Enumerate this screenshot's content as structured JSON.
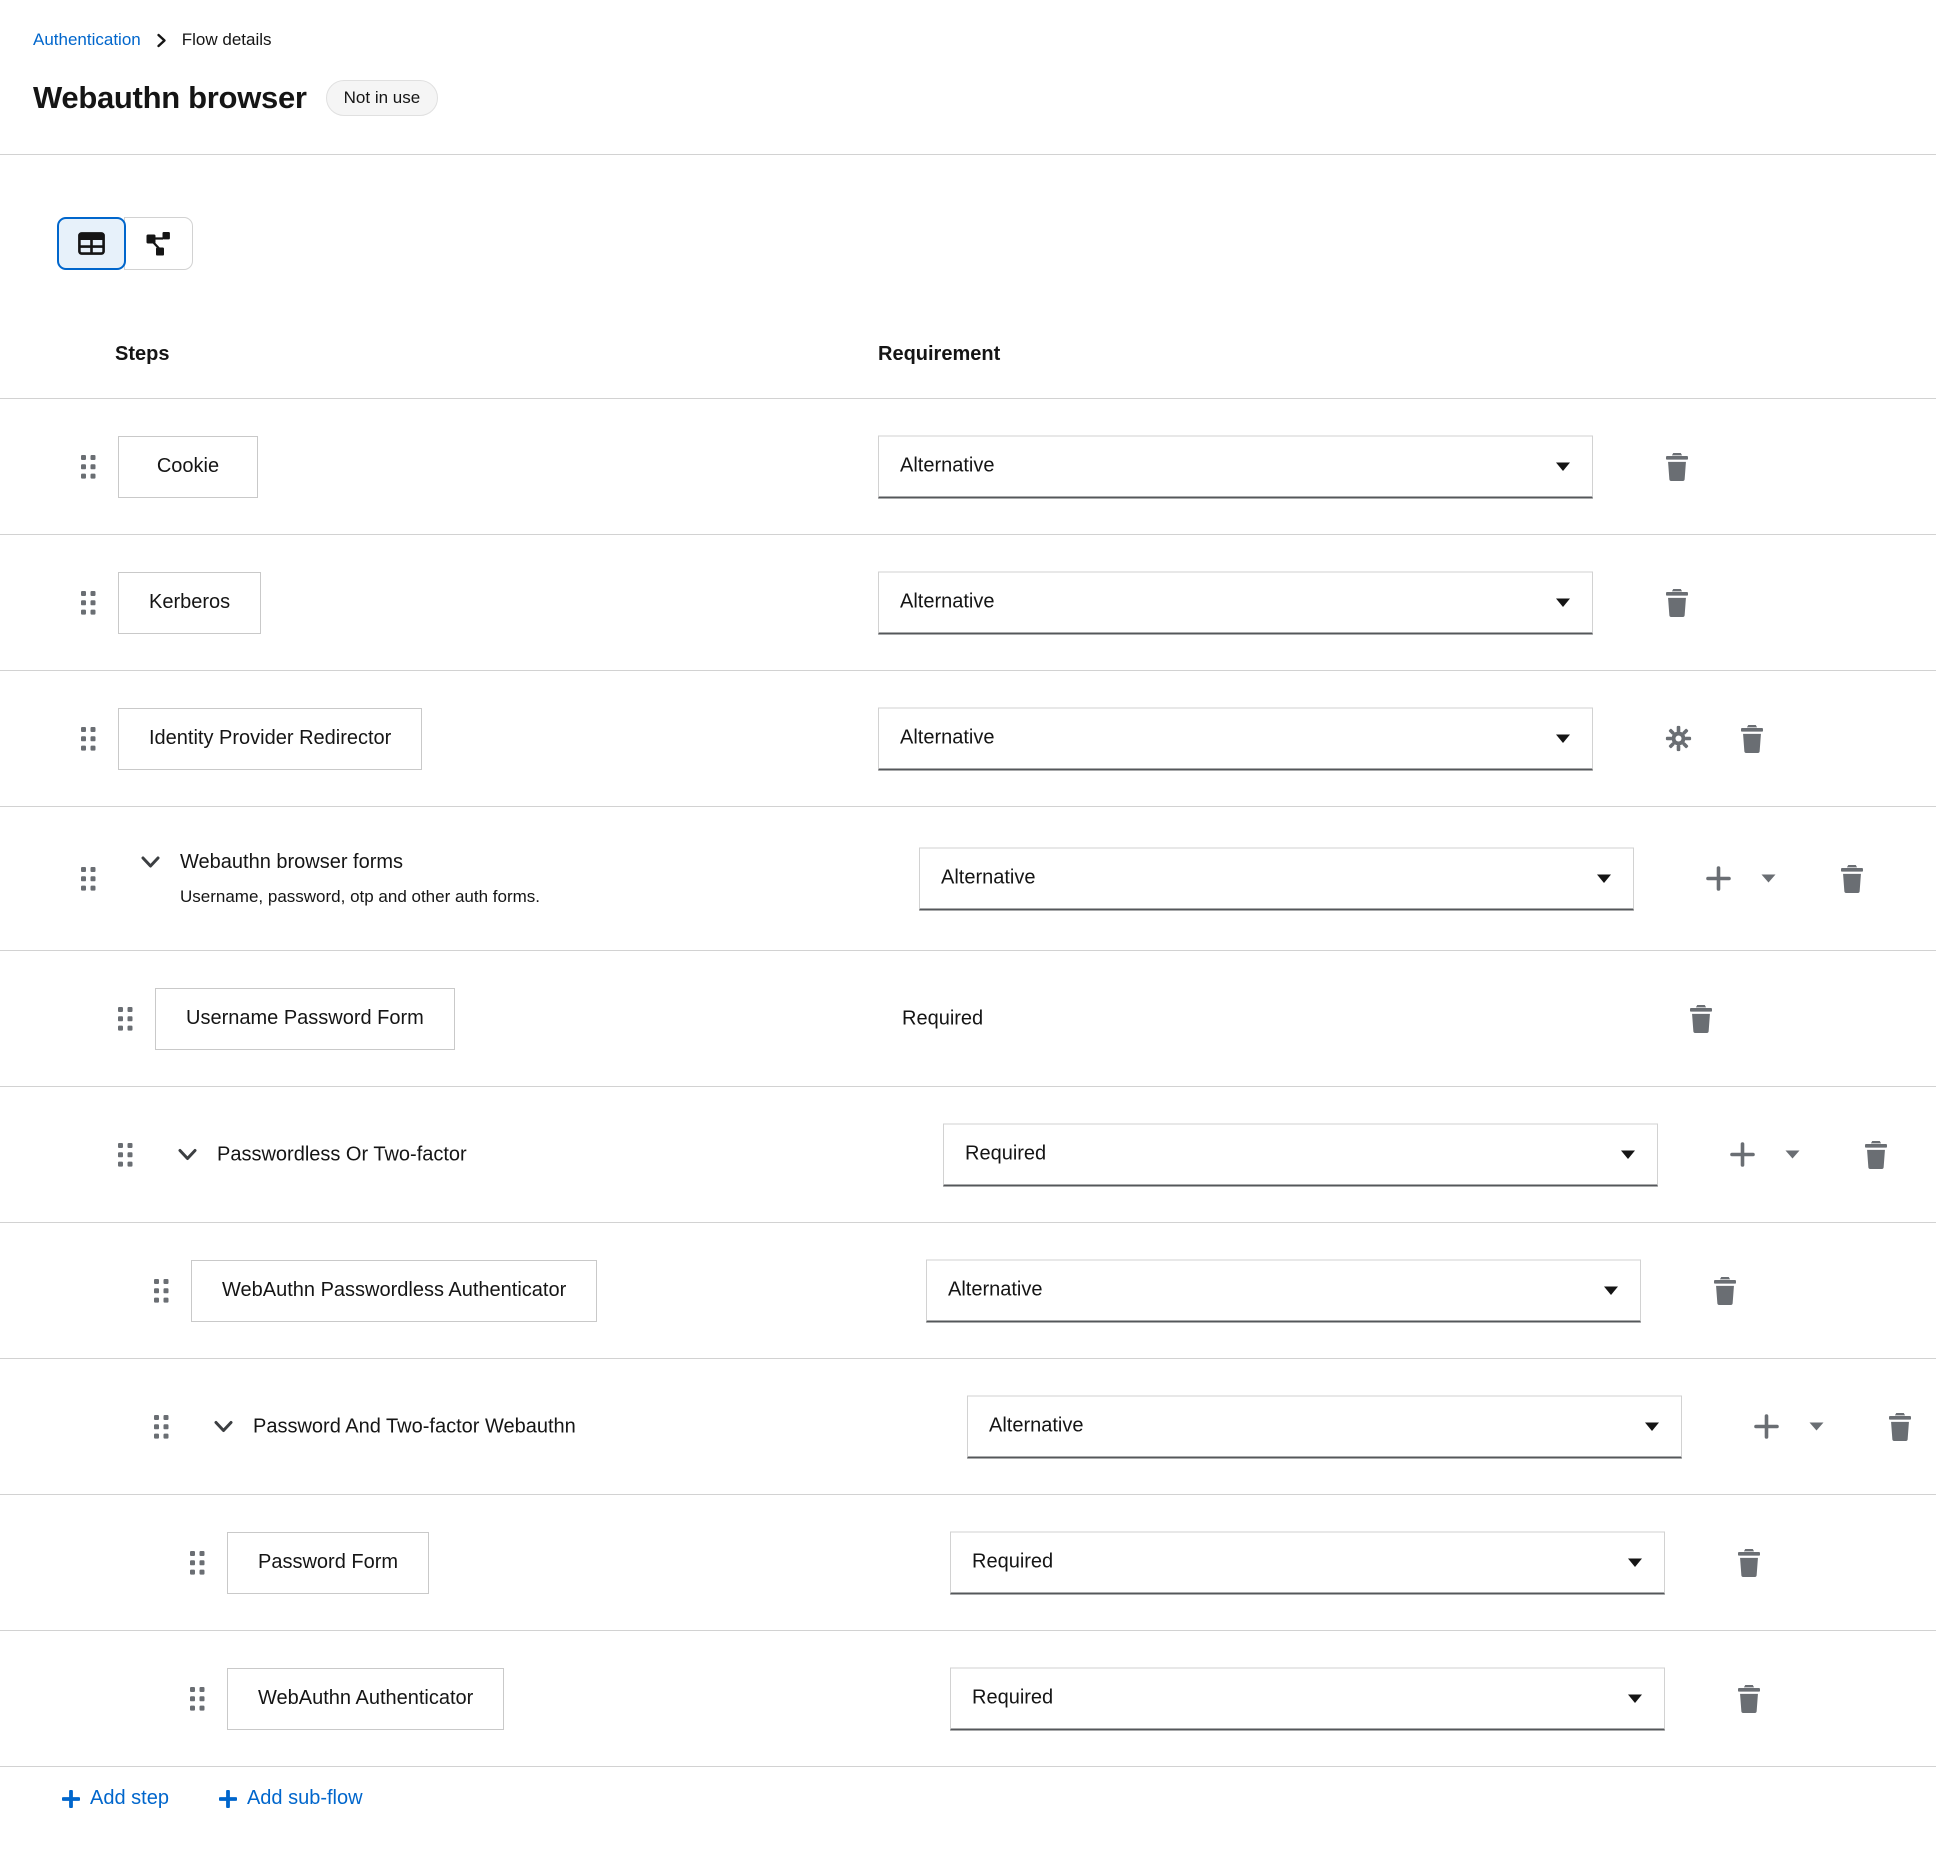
{
  "breadcrumb": {
    "items": [
      "Authentication",
      "Flow details"
    ]
  },
  "header": {
    "title": "Webauthn browser",
    "status_badge": "Not in use"
  },
  "toolbar": {
    "view_toggle": [
      {
        "id": "table-view",
        "selected": true
      },
      {
        "id": "diagram-view",
        "selected": false
      }
    ]
  },
  "table": {
    "columns": {
      "steps": "Steps",
      "requirement": "Requirement"
    },
    "rows": [
      {
        "type": "step",
        "level": 0,
        "label": "Cookie",
        "requirement": {
          "control": "select",
          "value": "Alternative"
        },
        "actions": {
          "settings": false,
          "add": false,
          "delete": true
        }
      },
      {
        "type": "step",
        "level": 0,
        "label": "Kerberos",
        "requirement": {
          "control": "select",
          "value": "Alternative"
        },
        "actions": {
          "settings": false,
          "add": false,
          "delete": true
        }
      },
      {
        "type": "step",
        "level": 0,
        "label": "Identity Provider Redirector",
        "requirement": {
          "control": "select",
          "value": "Alternative"
        },
        "actions": {
          "settings": true,
          "add": false,
          "delete": true
        }
      },
      {
        "type": "subflow",
        "level": 0,
        "label": "Webauthn browser forms",
        "description": "Username, password, otp and other auth forms.",
        "requirement": {
          "control": "select",
          "value": "Alternative"
        },
        "actions": {
          "settings": false,
          "add": true,
          "delete": true
        }
      },
      {
        "type": "step",
        "level": 1,
        "label": "Username Password Form",
        "requirement": {
          "control": "text",
          "value": "Required"
        },
        "actions": {
          "settings": false,
          "add": false,
          "delete": true
        }
      },
      {
        "type": "subflow",
        "level": 1,
        "label": "Passwordless Or Two-factor",
        "requirement": {
          "control": "select",
          "value": "Required"
        },
        "actions": {
          "settings": false,
          "add": true,
          "delete": true
        }
      },
      {
        "type": "step",
        "level": 2,
        "label": "WebAuthn Passwordless Authenticator",
        "requirement": {
          "control": "select",
          "value": "Alternative"
        },
        "actions": {
          "settings": false,
          "add": false,
          "delete": true
        }
      },
      {
        "type": "subflow",
        "level": 2,
        "label": "Password And Two-factor Webauthn",
        "requirement": {
          "control": "select",
          "value": "Alternative"
        },
        "actions": {
          "settings": false,
          "add": true,
          "delete": true
        }
      },
      {
        "type": "step",
        "level": 3,
        "label": "Password Form",
        "requirement": {
          "control": "select",
          "value": "Required"
        },
        "actions": {
          "settings": false,
          "add": false,
          "delete": true
        }
      },
      {
        "type": "step",
        "level": 3,
        "label": "WebAuthn Authenticator",
        "requirement": {
          "control": "select",
          "value": "Required"
        },
        "actions": {
          "settings": false,
          "add": false,
          "delete": true
        }
      }
    ]
  },
  "footer": {
    "add_step": "Add step",
    "add_subflow": "Add sub-flow"
  },
  "colors": {
    "accent": "#0066cc",
    "icon_gray": "#6a6e73",
    "text": "#151515",
    "border": "#d2d2d2",
    "selected_bg": "#e7f1fa"
  }
}
